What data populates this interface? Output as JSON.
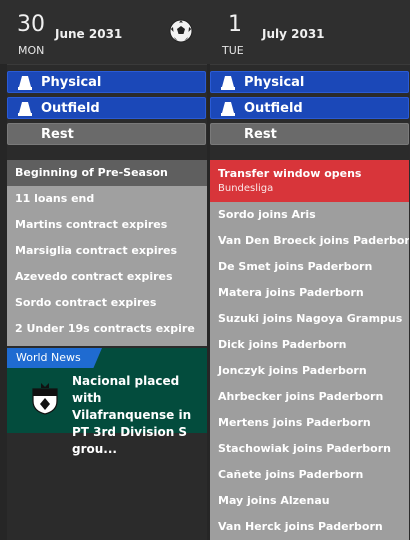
{
  "header": {
    "left": {
      "day": "30",
      "month_year": "June 2031",
      "dow": "MON"
    },
    "right": {
      "day": "1",
      "month_year": "July 2031",
      "dow": "TUE"
    },
    "icons": {
      "center": "football-icon"
    }
  },
  "left_column": {
    "pills": [
      {
        "label": "Physical",
        "icon": "training-cone-icon"
      },
      {
        "label": "Outfield",
        "icon": "training-cone-icon"
      },
      {
        "label": "Rest"
      }
    ],
    "events_header": "Beginning of Pre-Season",
    "events": [
      "11 loans end",
      "Martins contract expires",
      "Marsiglia contract expires",
      "Azevedo contract expires",
      "Sordo contract expires",
      "2 Under 19s contracts expire"
    ],
    "news": {
      "tab": "World News",
      "headline": "Nacional placed with Vilafranquense in PT 3rd Division S grou..."
    }
  },
  "right_column": {
    "pills": [
      {
        "label": "Physical",
        "icon": "training-cone-icon"
      },
      {
        "label": "Outfield",
        "icon": "training-cone-icon"
      },
      {
        "label": "Rest"
      }
    ],
    "transfer_header": {
      "title": "Transfer window opens",
      "subtitle": "Bundesliga"
    },
    "transfers": [
      "Sordo joins Aris",
      "Van Den Broeck joins Paderborn",
      "De Smet joins Paderborn",
      "Matera joins Paderborn",
      "Suzuki joins Nagoya Grampus",
      "Dick joins Paderborn",
      "Jonczyk joins Paderborn",
      "Ahrbecker joins Paderborn",
      "Mertens joins Paderborn",
      "Stachowiak joins Paderborn",
      "Cañete joins Paderborn",
      "May joins Alzenau",
      "Van Herck joins Paderborn"
    ]
  },
  "colors": {
    "blue_pill": "#1b48b8",
    "grey_pill": "#6a6a6a",
    "transfer_red": "#d8353a",
    "news_green": "#034c3d",
    "news_tab_blue": "#1f6bd1"
  }
}
